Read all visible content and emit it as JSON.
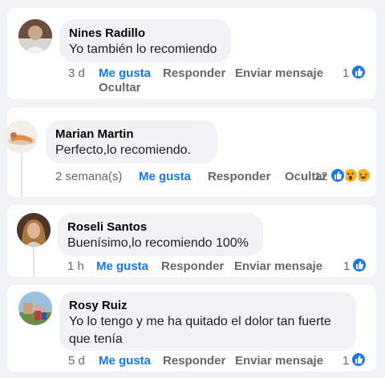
{
  "colors": {
    "link": "#1877f2",
    "muted": "#65676b",
    "bubble": "#f0f2f5",
    "background": "#f0f2f5"
  },
  "comments": [
    {
      "author": "Nines Radillo",
      "text": "Yo también lo recomiendo",
      "time": "3 d",
      "like": "Me gusta",
      "reply": "Responder",
      "send": "Enviar mensaje",
      "hide": "Ocultar",
      "count": "1",
      "reactions": [
        "like-icon"
      ]
    },
    {
      "author": "Marian Martin",
      "text": "Perfecto,lo recomiendo.",
      "time": "2 semana(s)",
      "like": "Me gusta",
      "reply": "Responder",
      "hide": "Ocultar",
      "count": "12",
      "reactions": [
        "like-icon",
        "wow-icon",
        "haha-icon"
      ]
    },
    {
      "author": "Roseli Santos",
      "text": "Buenísimo,lo recomiendo 100%",
      "time": "1 h",
      "like": "Me gusta",
      "reply": "Responder",
      "send": "Enviar mensaje",
      "count": "1",
      "reactions": [
        "like-icon"
      ]
    },
    {
      "author": "Rosy Ruiz",
      "text_line1": "Yo lo tengo y me ha quitado el dolor tan fuerte",
      "text_line2": "que tenía",
      "time": "5 d",
      "like": "Me gusta",
      "reply": "Responder",
      "send": "Enviar mensaje",
      "count": "1",
      "reactions": [
        "like-icon"
      ]
    }
  ]
}
